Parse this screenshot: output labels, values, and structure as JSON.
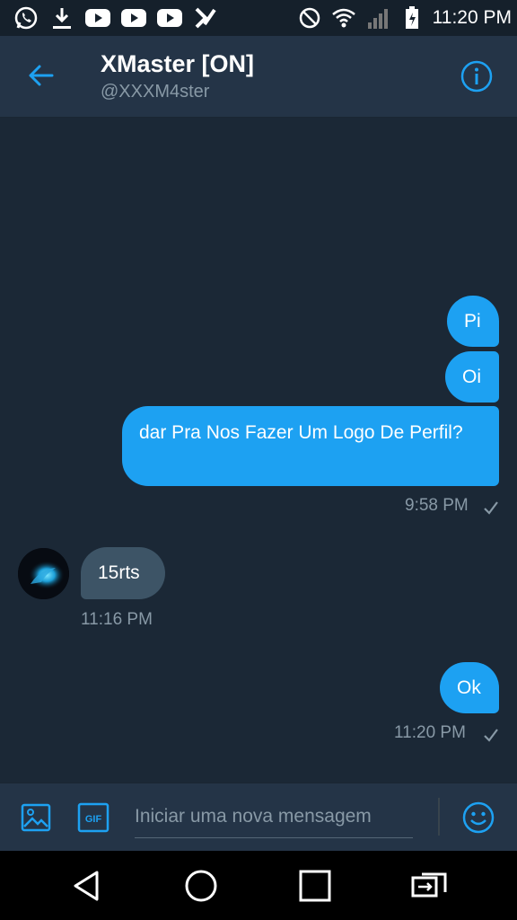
{
  "status_bar": {
    "time": "11:20 PM",
    "left_icons": [
      "whatsapp-icon",
      "download-icon",
      "youtube-icon",
      "youtube-icon",
      "youtube-icon",
      "app-icon"
    ],
    "right_icons": [
      "no-disturb-icon",
      "wifi-icon",
      "signal-icon",
      "battery-icon"
    ]
  },
  "header": {
    "title": "XMaster [ON]",
    "handle": "@XXXM4ster"
  },
  "messages": [
    {
      "direction": "out",
      "text": "Pi"
    },
    {
      "direction": "out",
      "text": "Oi"
    },
    {
      "direction": "out",
      "text": "dar Pra Nos Fazer Um Logo De Perfil?"
    },
    {
      "direction": "out",
      "timestamp": "9:58 PM"
    },
    {
      "direction": "in",
      "text": "15rts"
    },
    {
      "direction": "in",
      "timestamp": "11:16 PM"
    },
    {
      "direction": "out",
      "text": "Ok"
    },
    {
      "direction": "out",
      "timestamp": "11:20 PM"
    }
  ],
  "composer": {
    "placeholder": "Iniciar uma nova mensagem",
    "value": ""
  },
  "colors": {
    "accent": "#1da1f2",
    "background": "#1b2836",
    "header": "#243447",
    "incoming_bubble": "#3d5466",
    "muted_text": "#8899a6"
  }
}
